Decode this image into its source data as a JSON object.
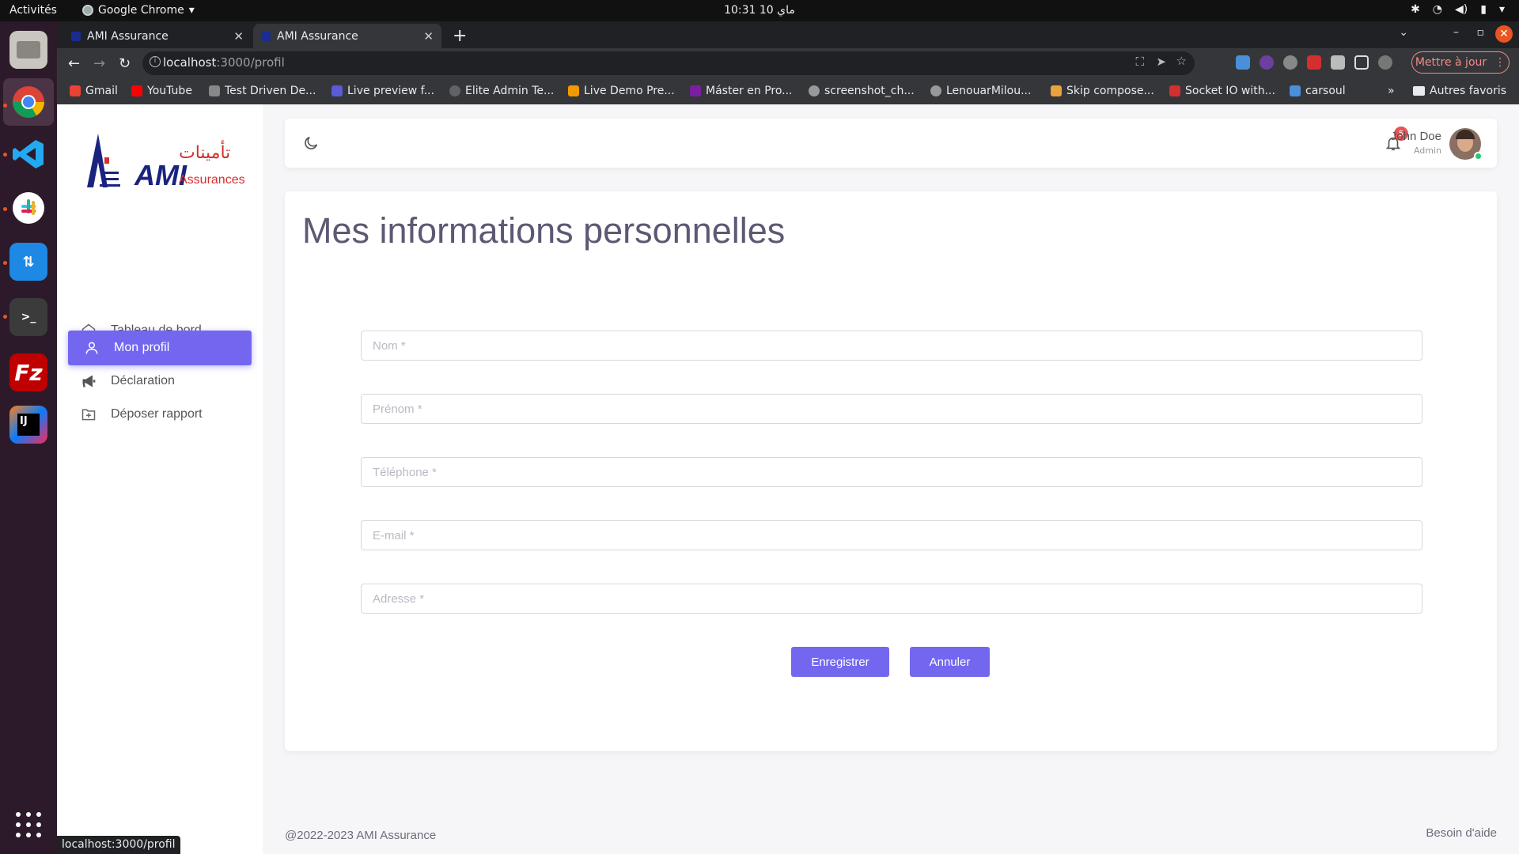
{
  "os": {
    "activities": "Activités",
    "app_name": "Google Chrome",
    "clock": "10:31  10 ماي"
  },
  "browser": {
    "tabs": [
      {
        "title": "AMI Assurance"
      },
      {
        "title": "AMI Assurance"
      }
    ],
    "url_host": "localhost",
    "url_path": ":3000/profil",
    "update_button": "Mettre à jour",
    "bookmarks": [
      {
        "label": "Gmail",
        "color": "#ea4335"
      },
      {
        "label": "YouTube",
        "color": "#ff0000"
      },
      {
        "label": "Test Driven De...",
        "color": "#888888"
      },
      {
        "label": "Live preview f...",
        "color": "#5b5bd6"
      },
      {
        "label": "Elite Admin Te...",
        "color": "#5f6368"
      },
      {
        "label": "Live Demo Pre...",
        "color": "#f29900"
      },
      {
        "label": "Máster en Pro...",
        "color": "#7b1fa2"
      },
      {
        "label": "screenshot_ch...",
        "color": "#999999"
      },
      {
        "label": "LenouarMilou...",
        "color": "#999999"
      },
      {
        "label": "Skip compose...",
        "color": "#e8a33d"
      },
      {
        "label": "Socket IO with...",
        "color": "#d32f2f"
      },
      {
        "label": "carsoul",
        "color": "#4a90d9"
      }
    ],
    "more_bookmarks": "»",
    "other_bookmarks": "Autres favoris",
    "status_url": "localhost:3000/profil"
  },
  "sidebar": {
    "logo_text": "AMI",
    "logo_sub": "Assurances",
    "logo_arabic": "تأمينات",
    "items": [
      {
        "label": "Tableau de bord",
        "icon": "home-icon"
      },
      {
        "label": "Mon profil",
        "icon": "user-icon"
      },
      {
        "label": "Déclaration",
        "icon": "megaphone-icon"
      },
      {
        "label": "Déposer rapport",
        "icon": "folder-plus-icon"
      }
    ]
  },
  "header": {
    "notifications": "5",
    "user_name": "John Doe",
    "user_role": "Admin"
  },
  "main": {
    "title": "Mes informations personnelles",
    "fields": [
      {
        "placeholder": "Nom *",
        "value": ""
      },
      {
        "placeholder": "Prénom *",
        "value": ""
      },
      {
        "placeholder": "Téléphone *",
        "value": ""
      },
      {
        "placeholder": "E-mail *",
        "value": ""
      },
      {
        "placeholder": "Adresse *",
        "value": ""
      }
    ],
    "save_label": "Enregistrer",
    "cancel_label": "Annuler"
  },
  "footer": {
    "copyright": "@2022-2023 AMI Assurance",
    "help": "Besoin d'aide"
  },
  "colors": {
    "accent": "#7367f0",
    "badge": "#ea5455",
    "online": "#28c76f"
  }
}
